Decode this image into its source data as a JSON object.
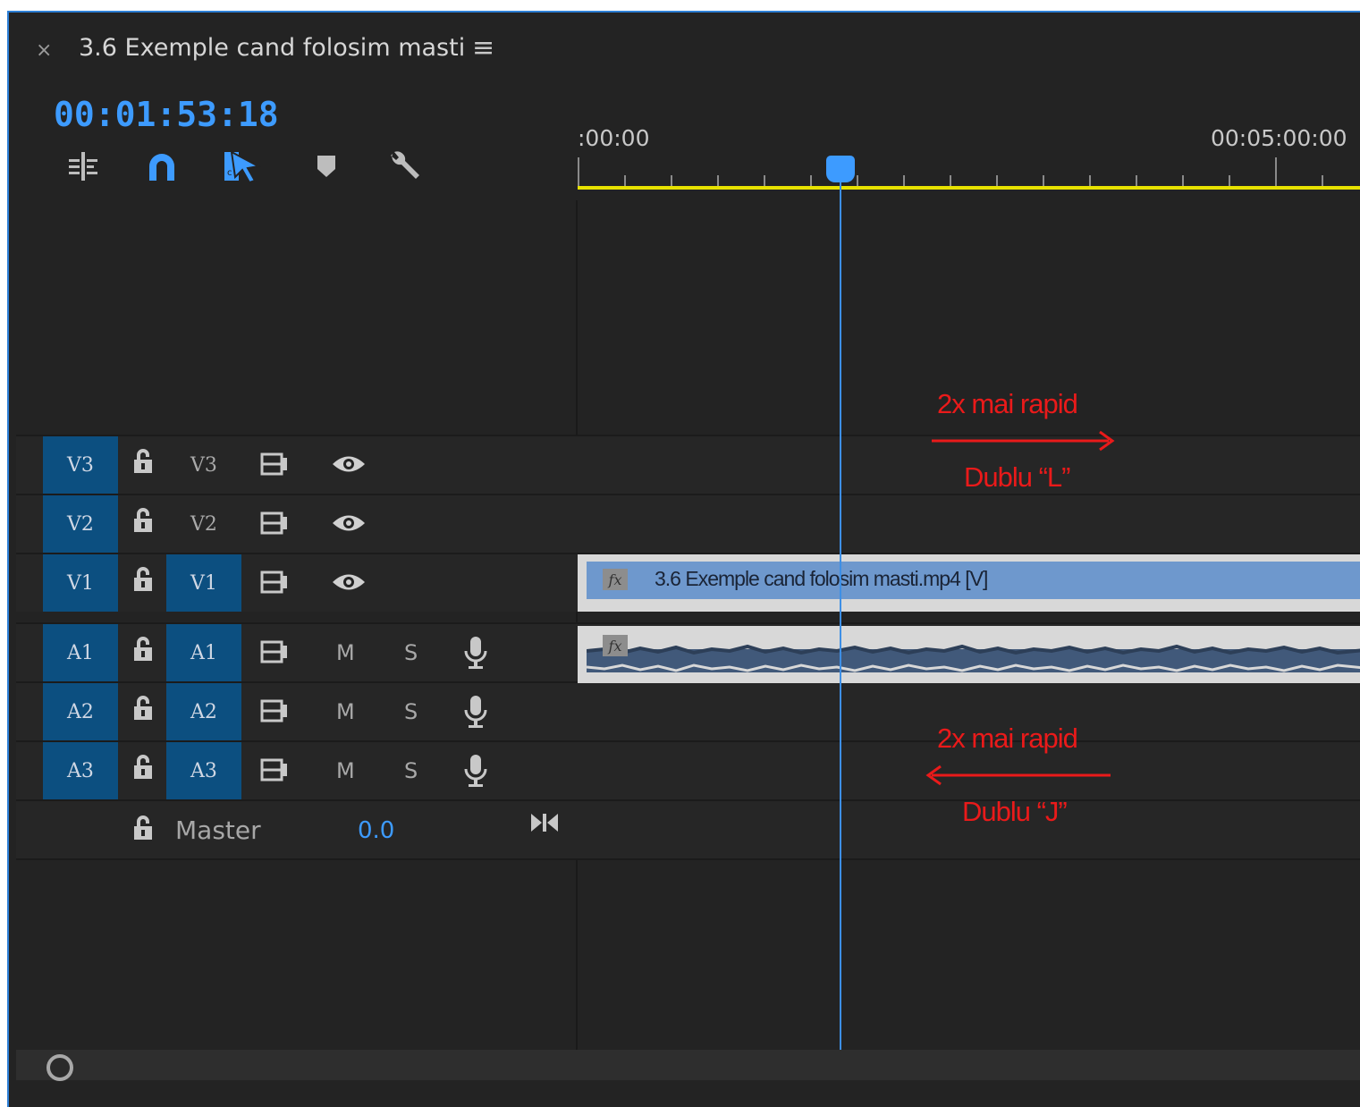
{
  "tab": {
    "close_label": "×",
    "title": "3.6 Exemple cand folosim masti",
    "menu_label": "≡"
  },
  "timecode": "00:01:53:18",
  "toolbar": {
    "tools": [
      "insert-nest-icon",
      "snap-magnet-icon",
      "linked-selection-icon",
      "add-marker-icon",
      "settings-wrench-icon"
    ]
  },
  "ruler": {
    "start_label": ":00:00",
    "end_label": "00:05:00:00"
  },
  "tracks": {
    "video": [
      {
        "source": "V3",
        "target": "V3",
        "target_active": false
      },
      {
        "source": "V2",
        "target": "V2",
        "target_active": false
      },
      {
        "source": "V1",
        "target": "V1",
        "target_active": true
      }
    ],
    "audio": [
      {
        "source": "A1",
        "target": "A1",
        "mute": "M",
        "solo": "S"
      },
      {
        "source": "A2",
        "target": "A2",
        "mute": "M",
        "solo": "S"
      },
      {
        "source": "A3",
        "target": "A3",
        "mute": "M",
        "solo": "S"
      }
    ],
    "master": {
      "label": "Master",
      "value": "0.0"
    }
  },
  "clips": {
    "video": {
      "label": "3.6 Exemple cand folosim masti.mp4 [V]",
      "fx": "fx"
    },
    "audio": {
      "fx": "fx"
    }
  },
  "annotations": {
    "forward": {
      "title": "2x mai rapid",
      "subtitle": "Dublu “L”"
    },
    "backward": {
      "title": "2x mai rapid",
      "subtitle": "Dublu “J”"
    }
  },
  "colors": {
    "accent": "#3d9bff",
    "track_active": "#0c4f80",
    "work_area": "#e7e200",
    "annotation": "#ea1a1a",
    "video_clip": "#6e98cd"
  }
}
